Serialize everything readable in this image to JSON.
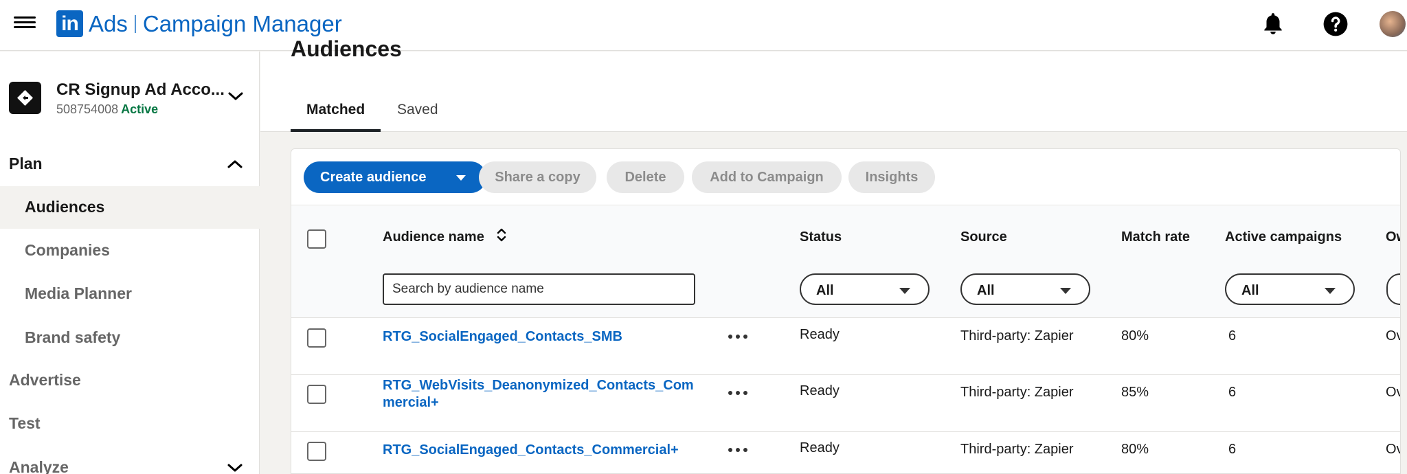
{
  "header": {
    "logo_text": "in",
    "brand_ads": "Ads",
    "brand_product": "Campaign Manager"
  },
  "account": {
    "name": "CR Signup Ad Acco...",
    "id": "508754008",
    "status": "Active"
  },
  "sidebar": {
    "plan_label": "Plan",
    "items": [
      {
        "label": "Audiences",
        "active": true
      },
      {
        "label": "Companies"
      },
      {
        "label": "Media Planner"
      },
      {
        "label": "Brand safety"
      }
    ],
    "advertise_label": "Advertise",
    "test_label": "Test",
    "analyze_label": "Analyze"
  },
  "page": {
    "title": "Audiences",
    "tabs": [
      {
        "label": "Matched",
        "active": true
      },
      {
        "label": "Saved"
      }
    ]
  },
  "toolbar": {
    "create_label": "Create audience",
    "share_label": "Share a copy",
    "delete_label": "Delete",
    "add_campaign_label": "Add to Campaign",
    "insights_label": "Insights"
  },
  "table": {
    "headers": {
      "name": "Audience name",
      "status": "Status",
      "source": "Source",
      "match_rate": "Match rate",
      "active_campaigns": "Active campaigns",
      "owner": "Ow"
    },
    "filters": {
      "search_placeholder": "Search by audience name",
      "status": "All",
      "source": "All",
      "active_campaigns": "All"
    },
    "rows": [
      {
        "name": "RTG_SocialEngaged_Contacts_SMB",
        "status": "Ready",
        "source": "Third-party: Zapier",
        "match_rate": "80%",
        "active_campaigns": "6",
        "owner": "Ov"
      },
      {
        "name": "RTG_WebVisits_Deanonymized_Contacts_Commercial+",
        "status": "Ready",
        "source": "Third-party: Zapier",
        "match_rate": "85%",
        "active_campaigns": "6",
        "owner": "Ov"
      },
      {
        "name": "RTG_SocialEngaged_Contacts_Commercial+",
        "status": "Ready",
        "source": "Third-party: Zapier",
        "match_rate": "80%",
        "active_campaigns": "6",
        "owner": "Ov"
      }
    ]
  },
  "colors": {
    "brand_blue": "#0a66c2",
    "active_green": "#057642"
  },
  "icons": [
    "menu-icon",
    "notification-bell-icon",
    "help-icon",
    "chevron-down-icon",
    "chevron-up-icon",
    "sort-icon",
    "more-options-icon",
    "dropdown-caret-icon"
  ]
}
